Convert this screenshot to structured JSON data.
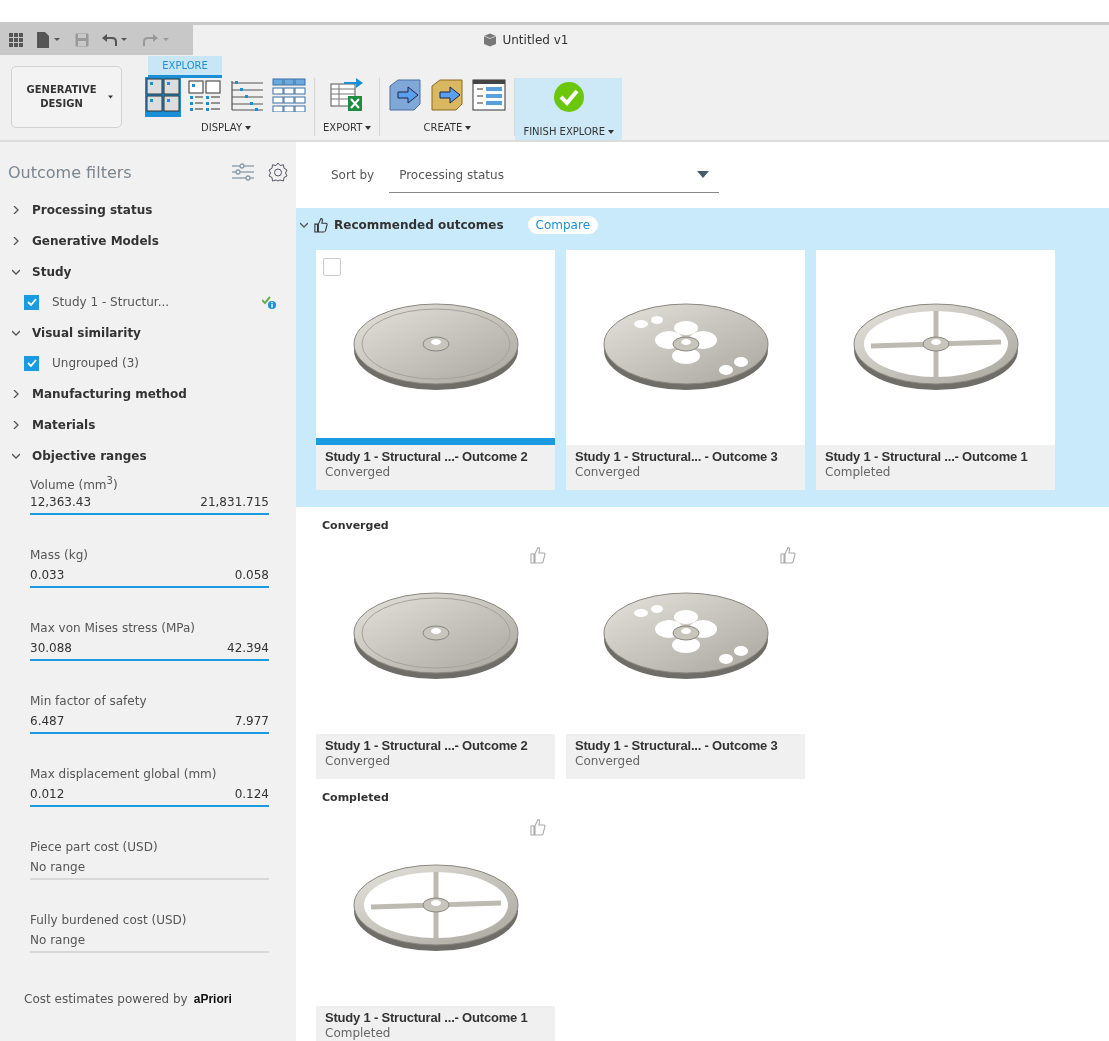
{
  "document": {
    "title": "Untitled v1"
  },
  "workspace": {
    "label": "GENERATIVE DESIGN"
  },
  "ribbon_tab": {
    "label": "EXPLORE"
  },
  "ribbon_groups": [
    {
      "kind": "display",
      "label": "DISPLAY",
      "tools": [
        {
          "selected": true
        },
        {
          "selected": false
        },
        {
          "selected": false
        },
        {
          "selected": false
        }
      ]
    },
    {
      "kind": "export",
      "label": "EXPORT"
    },
    {
      "kind": "create",
      "label": "CREATE"
    },
    {
      "kind": "finish",
      "label": "FINISH EXPLORE"
    }
  ],
  "sidebar": {
    "title": "Outcome filters",
    "filters": [
      {
        "label": "Processing status",
        "expanded": false
      },
      {
        "label": "Generative Models",
        "expanded": false
      },
      {
        "label": "Study",
        "expanded": true,
        "children": [
          {
            "label": "Study 1 - Structur...",
            "checked": true,
            "status": true
          }
        ]
      },
      {
        "label": "Visual similarity",
        "expanded": true,
        "children": [
          {
            "label": "Ungrouped (3)",
            "checked": true,
            "status": false
          }
        ]
      },
      {
        "label": "Manufacturing method",
        "expanded": false
      },
      {
        "label": "Materials",
        "expanded": false
      },
      {
        "label": "Objective ranges",
        "expanded": true
      }
    ],
    "ranges": [
      {
        "label": "Volume (mm$^{3}$)",
        "kind": "range",
        "min": "12,363.43",
        "max": "21,831.715"
      },
      {
        "label": "Mass (kg)",
        "kind": "range",
        "min": "0.033",
        "max": "0.058"
      },
      {
        "label": "Max von Mises stress (MPa)",
        "kind": "range",
        "min": "30.088",
        "max": "42.394"
      },
      {
        "label": "Min factor of safety",
        "kind": "range",
        "min": "6.487",
        "max": "7.977"
      },
      {
        "label": "Max displacement global (mm)",
        "kind": "range",
        "min": "0.012",
        "max": "0.124"
      },
      {
        "label": "Piece part cost (USD)",
        "kind": "empty",
        "value": "No range"
      },
      {
        "label": "Fully burdened cost (USD)",
        "kind": "empty",
        "value": "No range"
      }
    ],
    "footer": {
      "text": "Cost estimates powered by",
      "brand": "aPriori"
    }
  },
  "sort": {
    "label": "Sort by",
    "value": "Processing status"
  },
  "recommended": {
    "title": "Recommended outcomes",
    "expanded": true,
    "compare": "Compare",
    "cards": [
      {
        "title": "Study 1 - Structural ...- Outcome 2",
        "status": "Converged",
        "kind": "solid",
        "selected": true,
        "hovered": true,
        "checked": false
      },
      {
        "title": "Study 1 - Structural... - Outcome 3",
        "status": "Converged",
        "kind": "holes",
        "selected": false,
        "hovered": false
      },
      {
        "title": "Study 1 - Structural ...- Outcome 1",
        "status": "Completed",
        "kind": "spokes",
        "selected": false,
        "hovered": false
      }
    ]
  },
  "groups": [
    {
      "title": "Converged",
      "cards": [
        {
          "title": "Study 1 - Structural ...- Outcome 2",
          "status": "Converged",
          "kind": "solid",
          "selected": false
        },
        {
          "title": "Study 1 - Structural... - Outcome 3",
          "status": "Converged",
          "kind": "holes",
          "selected": false
        }
      ]
    },
    {
      "title": "Completed",
      "cards": [
        {
          "title": "Study 1 - Structural ...- Outcome 1",
          "status": "Completed",
          "kind": "spokes",
          "selected": false
        }
      ]
    }
  ]
}
